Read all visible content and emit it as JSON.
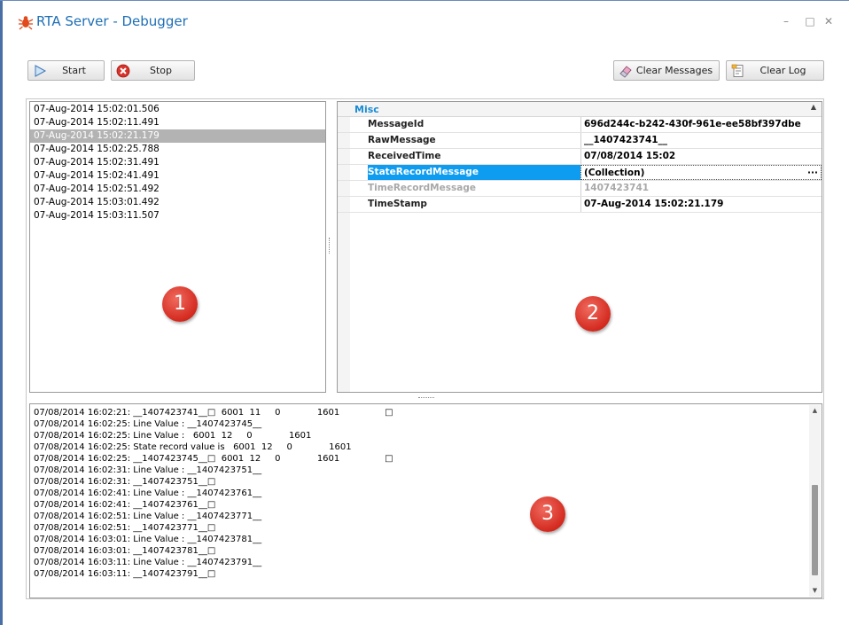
{
  "window": {
    "title": "RTA Server - Debugger",
    "controls": {
      "minimize": "–",
      "maximize": "□",
      "close": "✕"
    }
  },
  "toolbar": {
    "start_label": "Start",
    "stop_label": "Stop",
    "clear_messages_label": "Clear Messages",
    "clear_log_label": "Clear Log"
  },
  "messages": [
    "07-Aug-2014 15:02:01.506",
    "07-Aug-2014 15:02:11.491",
    "07-Aug-2014 15:02:21.179",
    "07-Aug-2014 15:02:25.788",
    "07-Aug-2014 15:02:31.491",
    "07-Aug-2014 15:02:41.491",
    "07-Aug-2014 15:02:51.492",
    "07-Aug-2014 15:03:01.492",
    "07-Aug-2014 15:03:11.507"
  ],
  "selected_message_index": 2,
  "property_grid": {
    "category": "Misc",
    "collapse_glyph": "▲",
    "rows": [
      {
        "name": "MessageId",
        "value": "696d244c-b242-430f-961e-ee58bf397dbe"
      },
      {
        "name": "RawMessage",
        "value": "__1407423741__"
      },
      {
        "name": "ReceivedTime",
        "value": "07/08/2014 15:02"
      },
      {
        "name": "StateRecordMessage",
        "value": "(Collection)"
      },
      {
        "name": "TimeRecordMessage",
        "value": "1407423741"
      },
      {
        "name": "TimeStamp",
        "value": "07-Aug-2014 15:02:21.179"
      }
    ],
    "ellipsis": "···"
  },
  "log_lines": [
    "07/08/2014 16:02:21: __1407423741__□  6001  11     0             1601                □",
    "07/08/2014 16:02:25: Line Value : __1407423745__",
    "07/08/2014 16:02:25: Line Value :   6001  12     0             1601",
    "07/08/2014 16:02:25: State record value is   6001  12     0             1601",
    "07/08/2014 16:02:25: __1407423745__□  6001  12     0             1601                □",
    "07/08/2014 16:02:31: Line Value : __1407423751__",
    "07/08/2014 16:02:31: __1407423751__□",
    "07/08/2014 16:02:41: Line Value : __1407423761__",
    "07/08/2014 16:02:41: __1407423761__□",
    "07/08/2014 16:02:51: Line Value : __1407423771__",
    "07/08/2014 16:02:51: __1407423771__□",
    "07/08/2014 16:03:01: Line Value : __1407423781__",
    "07/08/2014 16:03:01: __1407423781__□",
    "07/08/2014 16:03:11: Line Value : __1407423791__",
    "07/08/2014 16:03:11: __1407423791__□"
  ],
  "badges": {
    "one": "1",
    "two": "2",
    "three": "3"
  },
  "scrollbar": {
    "up": "▲",
    "down": "▼"
  },
  "colors": {
    "title": "#1e6fb5",
    "category": "#1a8bd6",
    "selection": "#0d9cf0",
    "badge": "#d42a1f"
  }
}
